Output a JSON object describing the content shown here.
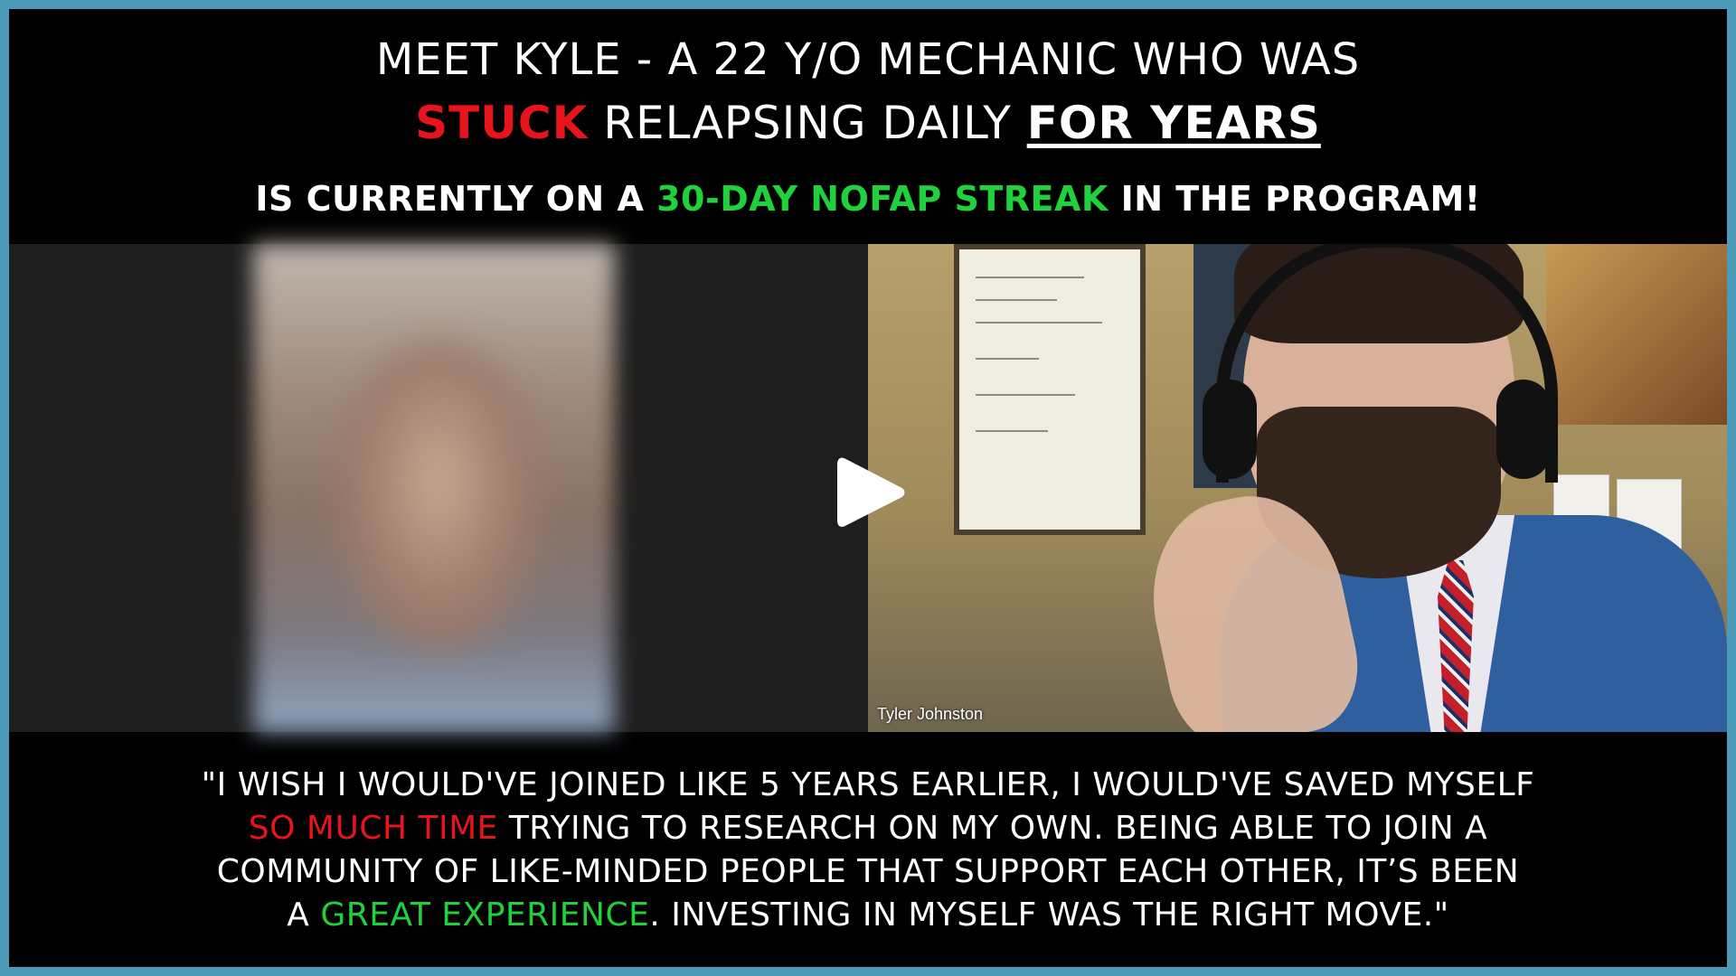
{
  "headline": {
    "line1": "MEET KYLE - A 22 Y/O MECHANIC WHO WAS",
    "line2_highlight": "STUCK",
    "line2_middle": " RELAPSING DAILY ",
    "line2_underlined": "FOR YEARS",
    "line3_prefix": "IS CURRENTLY ON A ",
    "line3_highlight": "30-DAY NOFAP STREAK",
    "line3_suffix": " IN THE PROGRAM!"
  },
  "video": {
    "participant_name": "Tyler Johnston",
    "play_icon": "play-icon"
  },
  "quote": {
    "part1": "\"I WISH I WOULD'VE JOINED LIKE 5 YEARS EARLIER, I WOULD'VE SAVED MYSELF",
    "part2_highlight": "SO MUCH TIME",
    "part2_rest": " TRYING TO RESEARCH ON MY OWN. BEING ABLE TO JOIN A",
    "part3": "COMMUNITY OF LIKE-MINDED PEOPLE THAT SUPPORT EACH OTHER, IT’S BEEN",
    "part4_prefix": "A ",
    "part4_highlight": "GREAT EXPERIENCE",
    "part4_suffix": ". INVESTING IN MYSELF WAS THE RIGHT MOVE.\""
  },
  "colors": {
    "frame_border": "#4a9ab8",
    "highlight_red": "#e8141b",
    "highlight_green": "#1fd13a",
    "background": "#000000"
  }
}
